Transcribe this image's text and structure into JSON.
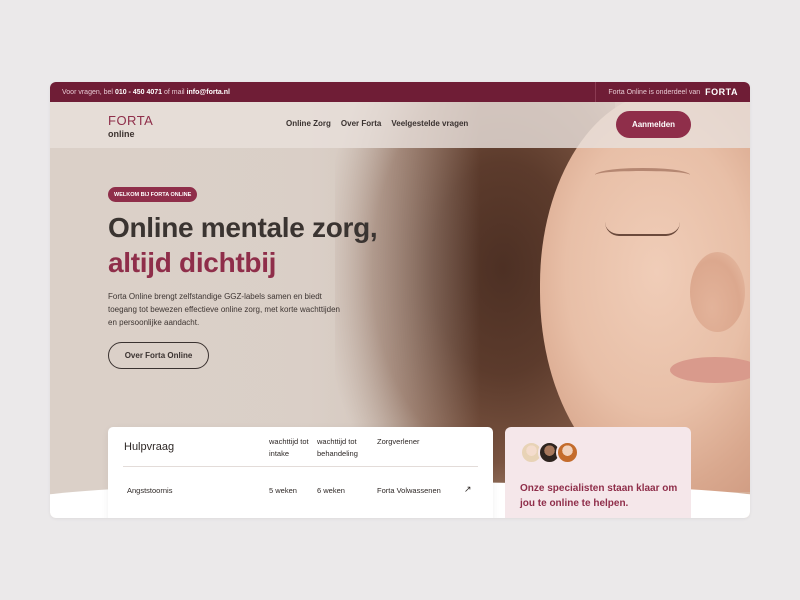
{
  "topbar": {
    "contact_prefix": "Voor vragen, bel",
    "phone": "010 - 450 4071",
    "contact_mid": "of mail",
    "email": "info@forta.nl",
    "parent_text": "Forta Online is onderdeel van",
    "parent_brand": "FORTA"
  },
  "nav": {
    "logo_top": "FORTA",
    "logo_bottom": "online",
    "links": [
      "Online Zorg",
      "Over Forta",
      "Veelgestelde vragen"
    ],
    "cta": "Aanmelden"
  },
  "hero": {
    "badge": "WELKOM BIJ FORTA ONLINE",
    "title_line1": "Online mentale zorg,",
    "title_line2": "altijd dichtbij",
    "lead": "Forta Online brengt zelfstandige GGZ-labels samen en biedt toegang tot bewezen effectieve online zorg, met korte wachttijden en persoonlijke aandacht.",
    "button": "Over Forta Online"
  },
  "table": {
    "header": "Hulpvraag",
    "col_intake": "wachttijd tot intake",
    "col_behandeling": "wachttijd tot behandeling",
    "col_zorgverlener": "Zorgverlener",
    "rows": [
      {
        "hulpvraag": "Angststoornis",
        "intake": "5 weken",
        "behandeling": "6 weken",
        "zorgverlener": "Forta Volwassenen"
      }
    ]
  },
  "promo": {
    "text": "Onze specialisten staan klaar om jou te online te helpen."
  },
  "colors": {
    "brand": "#8f2e4a",
    "topbar": "#6f1d36"
  }
}
